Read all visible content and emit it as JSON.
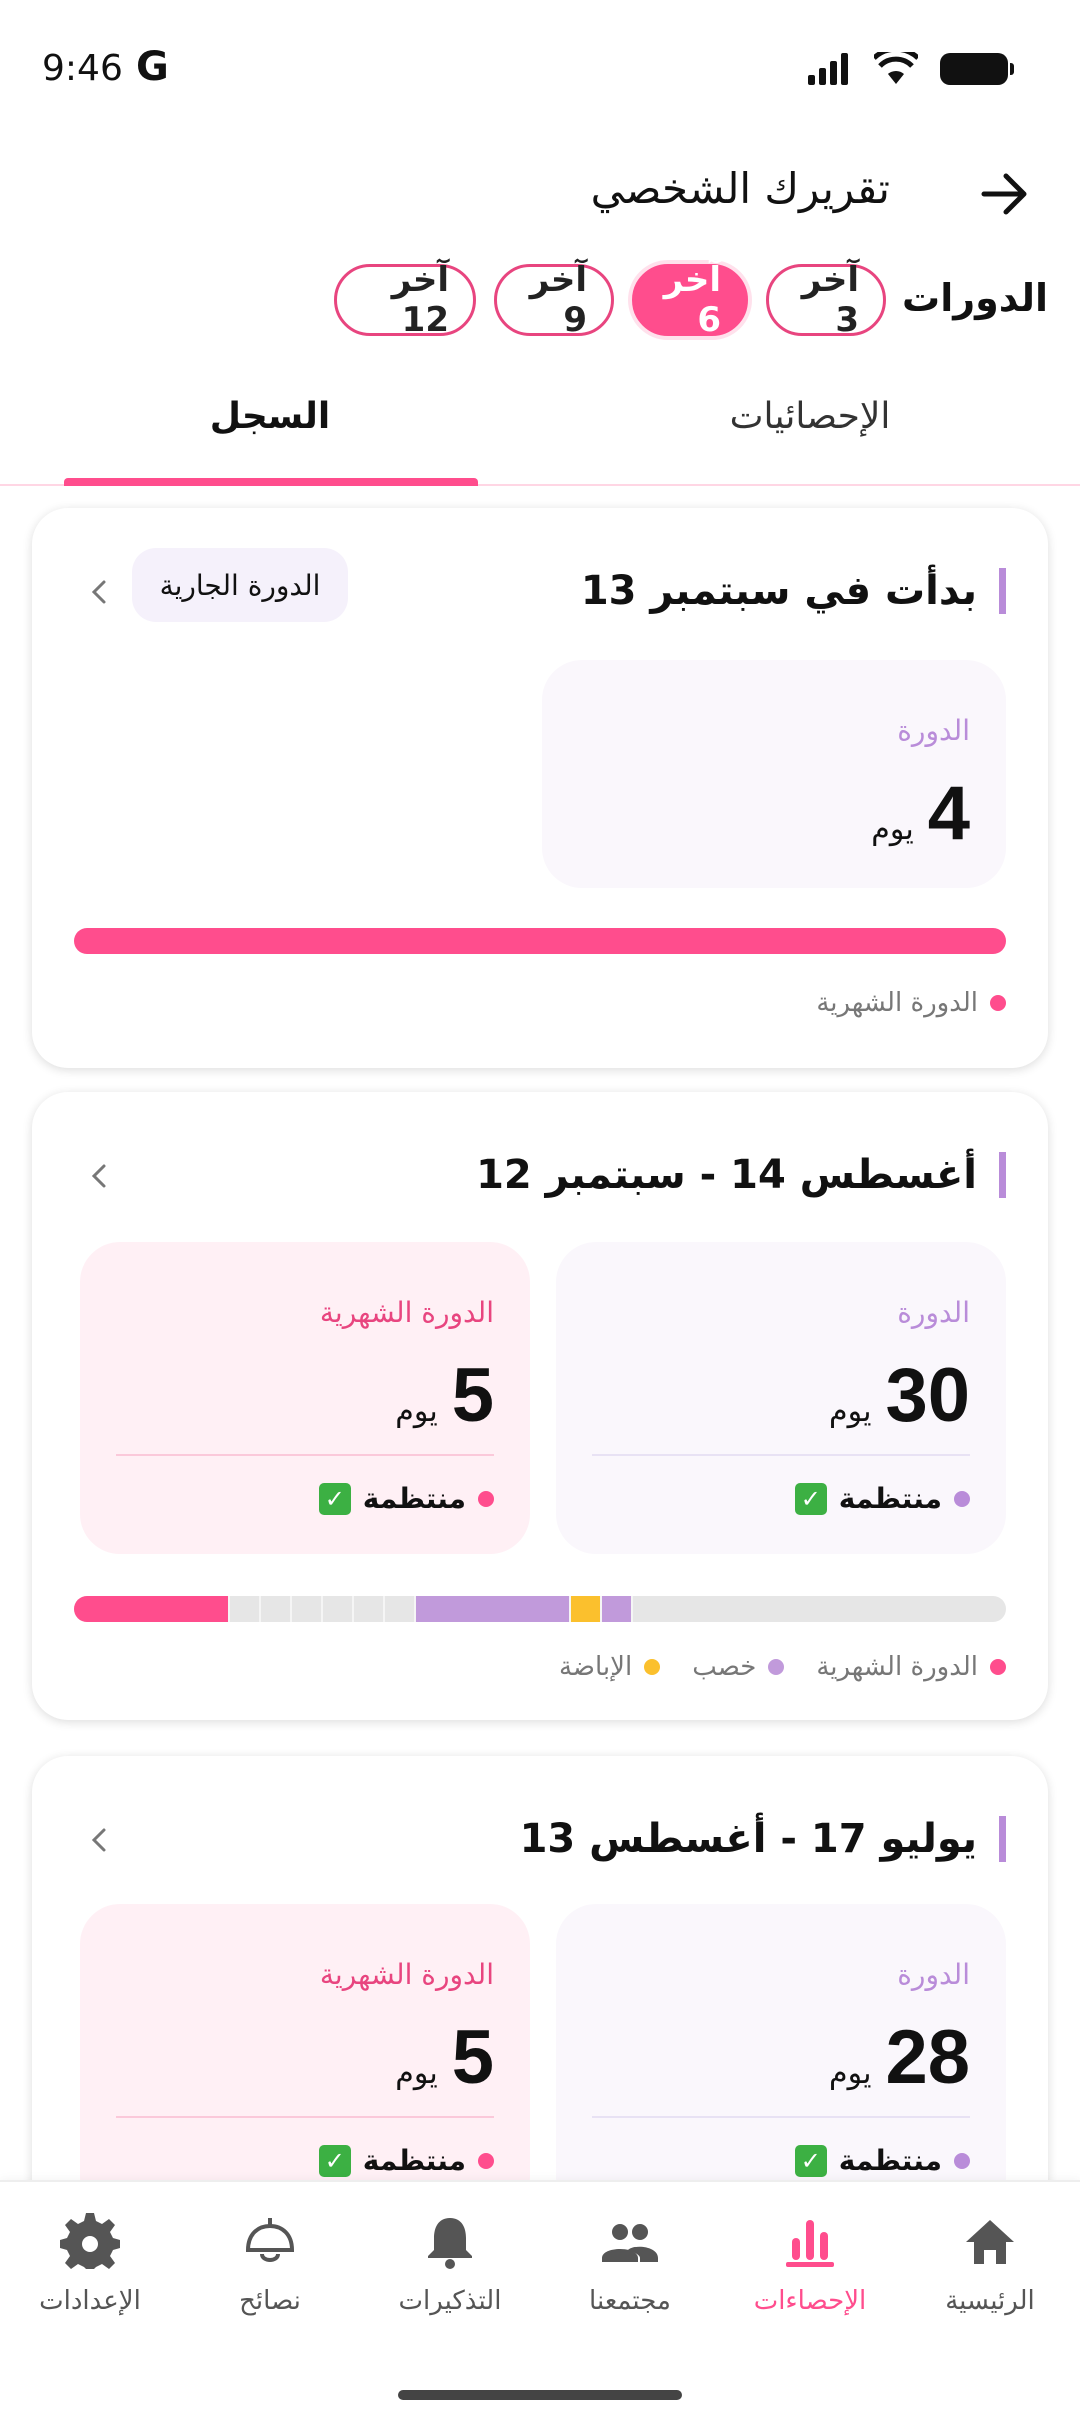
{
  "status": {
    "time": "9:46",
    "g": "G"
  },
  "header": {
    "title": "تقريرك الشخصي"
  },
  "filters": {
    "label": "الدورات",
    "chips": [
      {
        "label": "آخر 3",
        "active": false
      },
      {
        "label": "آخر 6",
        "active": true
      },
      {
        "label": "آخر 9",
        "active": false
      },
      {
        "label": "آخر 12",
        "active": false
      }
    ]
  },
  "tabs": {
    "stats": "الإحصائيات",
    "history": "السجل",
    "selected": "history"
  },
  "cards": [
    {
      "title": "بدأت في سبتمبر 13",
      "badge": "الدورة الجارية",
      "cycle": {
        "label": "الدورة",
        "value": "4",
        "unit": "يوم"
      },
      "legend": [
        "الدورة الشهرية"
      ]
    },
    {
      "title": "أغسطس 14 - سبتمبر 12",
      "cycle": {
        "label": "الدورة",
        "value": "30",
        "unit": "يوم",
        "status": "منتظمة"
      },
      "period": {
        "label": "الدورة الشهرية",
        "value": "5",
        "unit": "يوم",
        "status": "منتظمة"
      },
      "legend": [
        "الدورة الشهرية",
        "خصب",
        "الإباضة"
      ]
    },
    {
      "title": "يوليو 17 - أغسطس 13",
      "cycle": {
        "label": "الدورة",
        "value": "28",
        "unit": "يوم",
        "status": "منتظمة"
      },
      "period": {
        "label": "الدورة الشهرية",
        "value": "5",
        "unit": "يوم",
        "status": "منتظمة"
      }
    }
  ],
  "nav": [
    {
      "label": "الرئيسية",
      "icon": "home-icon",
      "active": false
    },
    {
      "label": "الإحصاءات",
      "icon": "bar-chart-icon",
      "active": true
    },
    {
      "label": "مجتمعنا",
      "icon": "people-icon",
      "active": false
    },
    {
      "label": "التذكيرات",
      "icon": "bell-icon",
      "active": false
    },
    {
      "label": "نصائح",
      "icon": "lamp-icon",
      "active": false
    },
    {
      "label": "الإعدادات",
      "icon": "gear-icon",
      "active": false
    }
  ],
  "colors": {
    "accent": "#ff4d8d",
    "fertile": "#b98cd9",
    "ovulation": "#fbc02d",
    "neutral": "#e6e6e6"
  }
}
